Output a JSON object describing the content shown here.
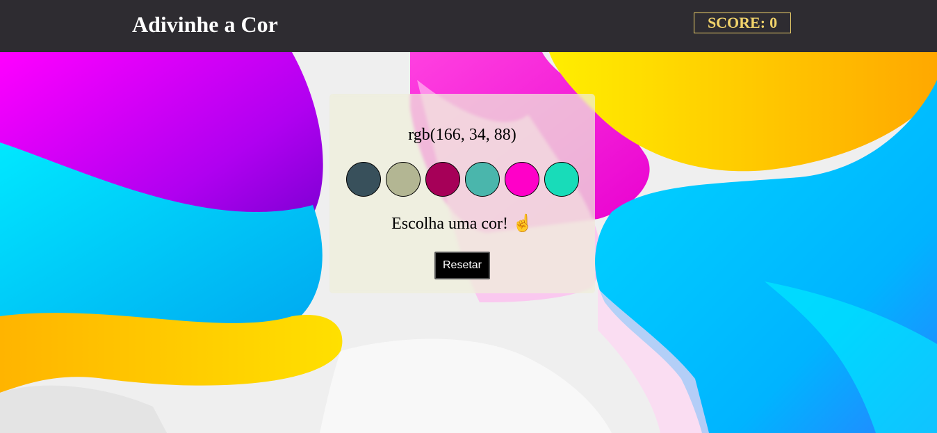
{
  "header": {
    "title": "Adivinhe a Cor",
    "score_label": "SCORE:",
    "score_value": "0"
  },
  "game": {
    "rgb_target": "rgb(166, 34, 88)",
    "balls": [
      {
        "color": "#38505b"
      },
      {
        "color": "#b3b693"
      },
      {
        "color": "#a60058"
      },
      {
        "color": "#4ab6ac"
      },
      {
        "color": "#ff00c8"
      },
      {
        "color": "#18dcb9"
      }
    ],
    "answer_text": "Escolha uma cor!",
    "answer_icon": "pointing-up-icon",
    "answer_emoji": "☝",
    "reset_label": "Resetar"
  },
  "colors": {
    "header_bg": "#2e2c31",
    "score_accent": "#f2d46b"
  }
}
